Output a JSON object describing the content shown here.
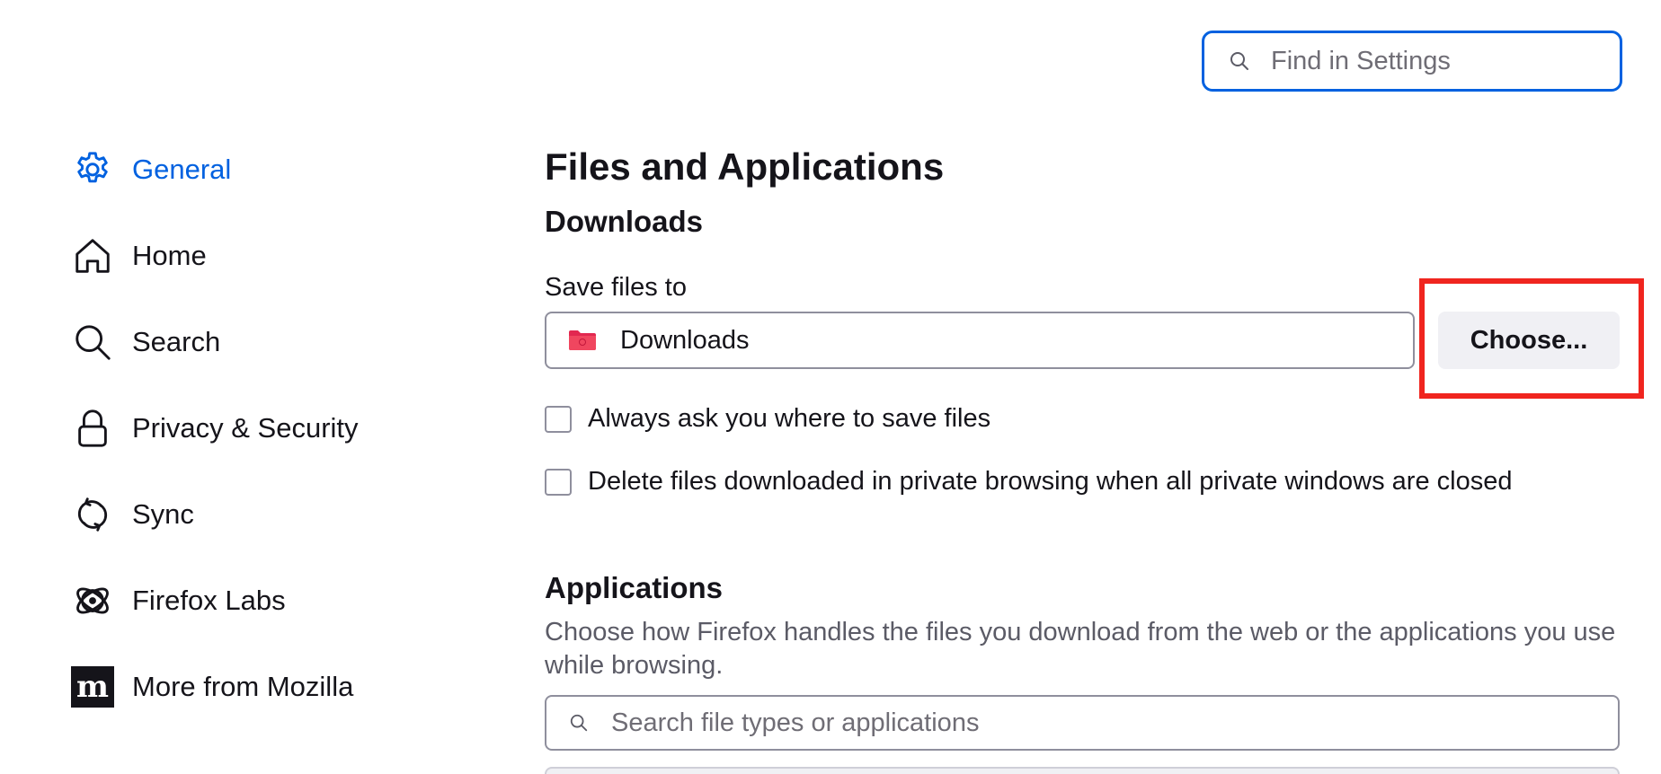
{
  "search": {
    "placeholder": "Find in Settings"
  },
  "sidebar": {
    "items": [
      {
        "label": "General",
        "icon": "gear-icon",
        "active": true
      },
      {
        "label": "Home",
        "icon": "home-icon",
        "active": false
      },
      {
        "label": "Search",
        "icon": "search-icon",
        "active": false
      },
      {
        "label": "Privacy & Security",
        "icon": "lock-icon",
        "active": false
      },
      {
        "label": "Sync",
        "icon": "sync-icon",
        "active": false
      },
      {
        "label": "Firefox Labs",
        "icon": "atom-icon",
        "active": false
      },
      {
        "label": "More from Mozilla",
        "icon": "mozilla-logo-icon",
        "active": false
      }
    ]
  },
  "main": {
    "title": "Files and Applications",
    "downloads": {
      "heading": "Downloads",
      "save_label": "Save files to",
      "folder_name": "Downloads",
      "choose_label": "Choose...",
      "always_ask_label": "Always ask you where to save files",
      "always_ask_checked": false,
      "delete_private_label": "Delete files downloaded in private browsing when all private windows are closed",
      "delete_private_checked": false
    },
    "applications": {
      "heading": "Applications",
      "description": "Choose how Firefox handles the files you download from the web or the applications you use while browsing.",
      "search_placeholder": "Search file types or applications"
    }
  },
  "colors": {
    "accent": "#0061e0",
    "highlight": "#f0251f",
    "folder": "#e22850"
  }
}
